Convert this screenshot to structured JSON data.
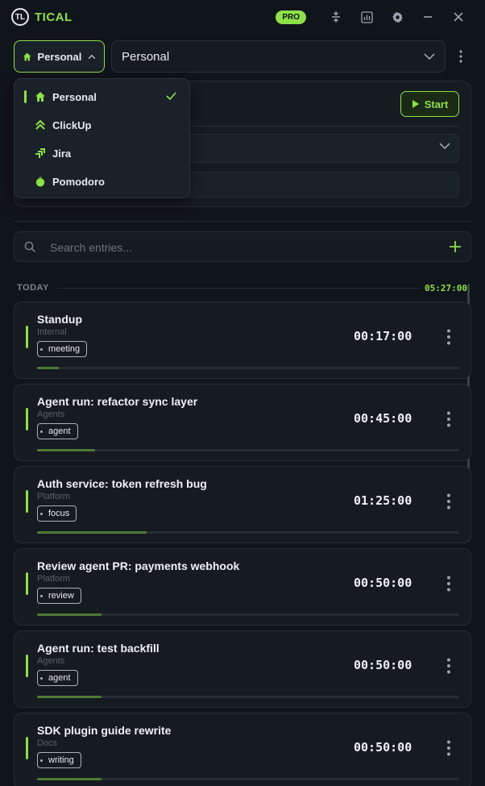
{
  "app": {
    "name": "TICAL",
    "logo_glyph": "TL",
    "pro_badge": "PRO",
    "accent_color": "#8ee04a"
  },
  "titlebar": {
    "icons": [
      "compact-icon",
      "chart-icon",
      "gear-icon",
      "minimize-icon",
      "close-icon"
    ]
  },
  "workspace": {
    "toggle_label": "Personal",
    "select_label": "Personal"
  },
  "timer": {
    "start_label": "Start"
  },
  "dropdown": {
    "items": [
      {
        "label": "Personal",
        "icon": "home-icon",
        "selected": true
      },
      {
        "label": "ClickUp",
        "icon": "clickup-icon",
        "selected": false
      },
      {
        "label": "Jira",
        "icon": "jira-icon",
        "selected": false
      },
      {
        "label": "Pomodoro",
        "icon": "tomato-icon",
        "selected": false
      }
    ]
  },
  "search": {
    "placeholder": "Search entries..."
  },
  "today": {
    "label": "TODAY",
    "total": "05:27:00"
  },
  "entries": [
    {
      "title": "Standup",
      "project": "Internal",
      "tag": "meeting",
      "duration": "00:17:00",
      "progress": 0.052
    },
    {
      "title": "Agent run: refactor sync layer",
      "project": "Agents",
      "tag": "agent",
      "duration": "00:45:00",
      "progress": 0.138
    },
    {
      "title": "Auth service: token refresh bug",
      "project": "Platform",
      "tag": "focus",
      "duration": "01:25:00",
      "progress": 0.26
    },
    {
      "title": "Review agent PR: payments webhook",
      "project": "Platform",
      "tag": "review",
      "duration": "00:50:00",
      "progress": 0.153
    },
    {
      "title": "Agent run: test backfill",
      "project": "Agents",
      "tag": "agent",
      "duration": "00:50:00",
      "progress": 0.153
    },
    {
      "title": "SDK plugin guide rewrite",
      "project": "Docs",
      "tag": "writing",
      "duration": "00:50:00",
      "progress": 0.153
    }
  ]
}
